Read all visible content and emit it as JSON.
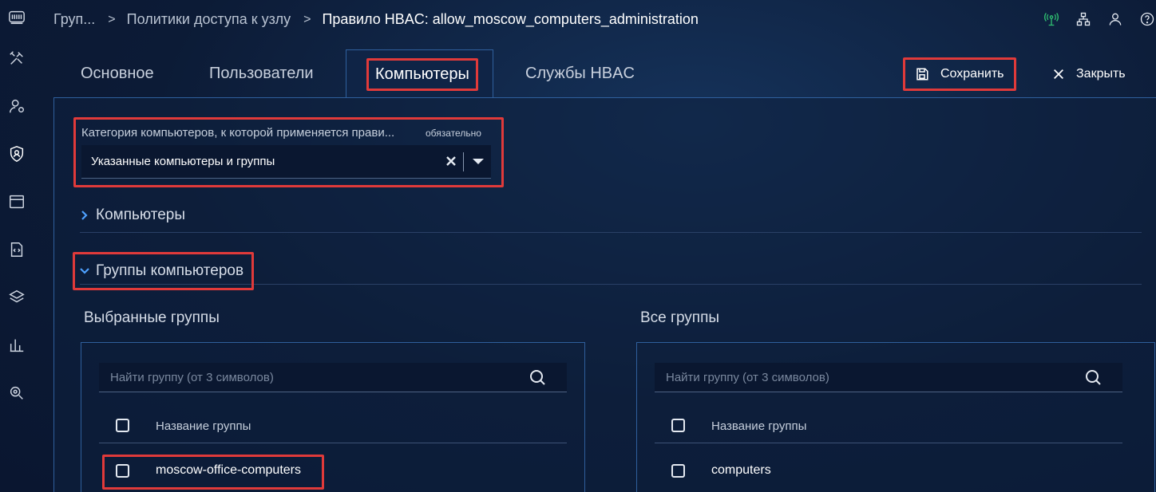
{
  "breadcrumb": {
    "items": [
      "Груп...",
      "Политики доступа к узлу",
      "Правило HBAC: allow_moscow_computers_administration"
    ],
    "separator": ">"
  },
  "header_icons": [
    "network-status-icon",
    "hierarchy-icon",
    "user-icon",
    "help-icon"
  ],
  "rail_icons": [
    "tools-icon",
    "user-settings-icon",
    "shield-user-icon",
    "window-icon",
    "code-file-icon",
    "layers-icon",
    "bar-chart-icon",
    "search-zoom-icon"
  ],
  "tabs": [
    {
      "label": "Основное"
    },
    {
      "label": "Пользователи"
    },
    {
      "label": "Компьютеры",
      "active": true
    },
    {
      "label": "Службы HBAC"
    }
  ],
  "actions": {
    "save_label": "Сохранить",
    "close_label": "Закрыть"
  },
  "category": {
    "label": "Категория компьютеров, к которой применяется прави...",
    "required": "обязательно",
    "value": "Указанные компьютеры и группы"
  },
  "accordions": [
    {
      "label": "Компьютеры",
      "expanded": false
    },
    {
      "label": "Группы компьютеров",
      "expanded": true
    }
  ],
  "selected_groups": {
    "title": "Выбранные группы",
    "search_placeholder": "Найти группу (от 3 символов)",
    "column": "Название группы",
    "rows": [
      "moscow-office-computers"
    ]
  },
  "all_groups": {
    "title": "Все группы",
    "search_placeholder": "Найти группу (от 3 символов)",
    "column": "Название группы",
    "rows": [
      "computers"
    ]
  },
  "colors": {
    "accent": "#4ea1ff",
    "highlight": "#e03a3a",
    "status_green": "#2fbf71"
  }
}
